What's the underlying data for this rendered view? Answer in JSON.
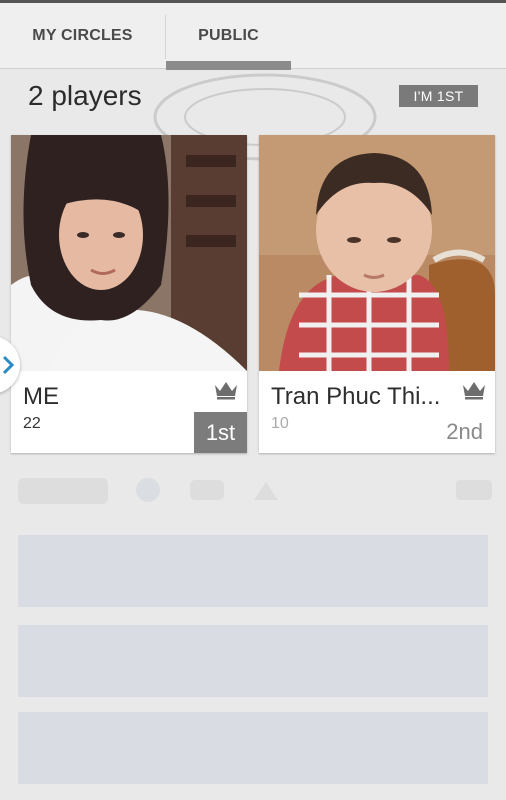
{
  "tabs": [
    {
      "label": "MY CIRCLES",
      "active": false
    },
    {
      "label": "PUBLIC",
      "active": true
    }
  ],
  "header": {
    "players_count": "2 players",
    "im_first_label": "I'M 1ST"
  },
  "players": [
    {
      "name": "ME",
      "score": "22",
      "rank": "1st",
      "highlighted": true
    },
    {
      "name": "Tran Phuc Thi...",
      "score": "10",
      "rank": "2nd",
      "highlighted": false
    }
  ],
  "icons": {
    "crown": "crown-icon",
    "side_arrow": "chevron-right-icon"
  },
  "colors": {
    "accent_gray": "#7c7c7c",
    "background": "#e9e9e9",
    "arrow_blue": "#2a8ac4"
  },
  "faded_buttons": [
    "",
    "",
    ""
  ]
}
